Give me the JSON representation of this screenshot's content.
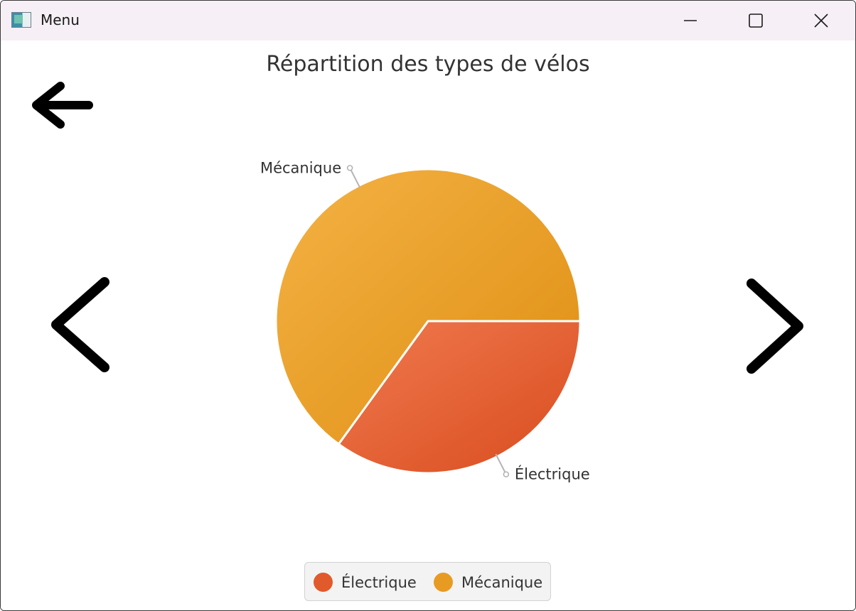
{
  "window": {
    "title": "Menu",
    "app_icon": "app-icon",
    "controls": [
      "minimize-icon",
      "maximize-icon",
      "close-icon"
    ]
  },
  "nav": {
    "back_icon": "arrow-left-icon",
    "prev_icon": "chevron-left-icon",
    "next_icon": "chevron-right-icon"
  },
  "colors": {
    "electrique": "#e15a2b",
    "mecanique": "#e89b22"
  },
  "chart_data": {
    "type": "pie",
    "title": "Répartition des types de vélos",
    "categories": [
      "Électrique",
      "Mécanique"
    ],
    "values": [
      35,
      65
    ],
    "legend_position": "bottom"
  }
}
